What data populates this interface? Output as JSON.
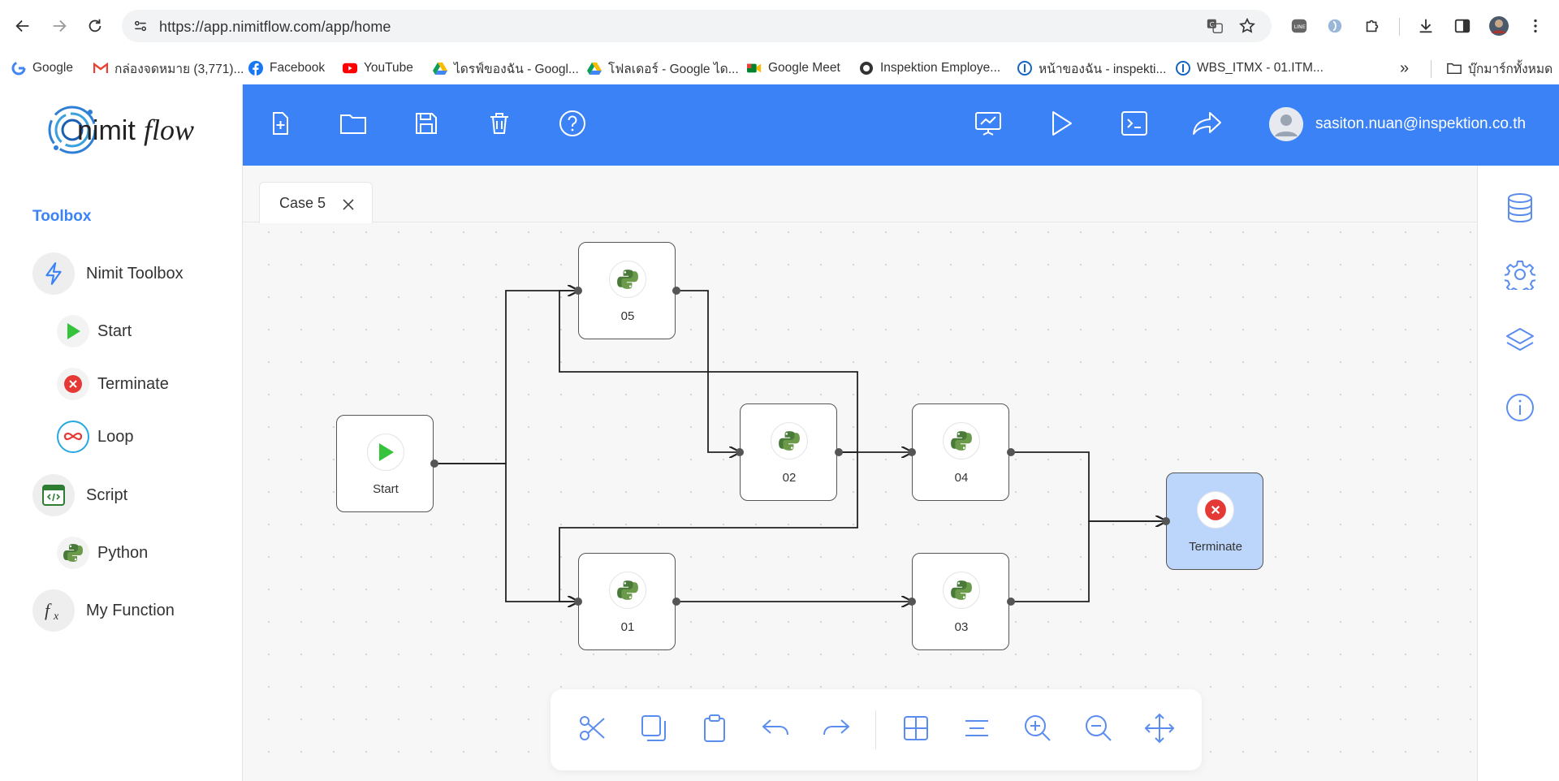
{
  "browser": {
    "url": "https://app.nimitflow.com/app/home",
    "bookmarks": [
      {
        "label": "Google",
        "icon": "google-icon"
      },
      {
        "label": "กล่องจดหมาย (3,771)...",
        "icon": "gmail-icon"
      },
      {
        "label": "Facebook",
        "icon": "facebook-icon"
      },
      {
        "label": "YouTube",
        "icon": "youtube-icon"
      },
      {
        "label": "ไดรฟ์ของฉัน - Googl...",
        "icon": "drive-icon"
      },
      {
        "label": "โฟลเดอร์ - Google ได...",
        "icon": "drive-icon"
      },
      {
        "label": "Google Meet",
        "icon": "meet-icon"
      },
      {
        "label": "Inspektion Employe...",
        "icon": "inspektion-icon"
      },
      {
        "label": "หน้าของฉัน - inspekti...",
        "icon": "info-icon"
      },
      {
        "label": "WBS_ITMX - 01.ITM...",
        "icon": "info-icon"
      }
    ],
    "bookmarks_more": "»",
    "all_bookmarks": "บุ๊กมาร์กทั้งหมด"
  },
  "app": {
    "logo_text_prefix": "nimit",
    "logo_text_suffix": "flow",
    "brand_color": "#3b82f6",
    "user_email": "sasiton.nuan@inspektion.co.th"
  },
  "sidebar": {
    "title": "Toolbox",
    "items": [
      {
        "label": "Nimit Toolbox",
        "icon": "lightning-icon",
        "level": 0
      },
      {
        "label": "Start",
        "icon": "play-icon",
        "level": 1
      },
      {
        "label": "Terminate",
        "icon": "terminate-icon",
        "level": 1
      },
      {
        "label": "Loop",
        "icon": "loop-icon",
        "level": 1
      },
      {
        "label": "Script",
        "icon": "script-icon",
        "level": 0
      },
      {
        "label": "Python",
        "icon": "python-icon",
        "level": 1
      },
      {
        "label": "My Function",
        "icon": "function-icon",
        "level": 0
      }
    ]
  },
  "tab": {
    "label": "Case 5"
  },
  "flow": {
    "nodes": [
      {
        "id": "start",
        "label": "Start",
        "type": "start"
      },
      {
        "id": "05",
        "label": "05",
        "type": "python"
      },
      {
        "id": "02",
        "label": "02",
        "type": "python"
      },
      {
        "id": "04",
        "label": "04",
        "type": "python"
      },
      {
        "id": "01",
        "label": "01",
        "type": "python"
      },
      {
        "id": "03",
        "label": "03",
        "type": "python"
      },
      {
        "id": "terminate",
        "label": "Terminate",
        "type": "terminate"
      }
    ],
    "edges": [
      [
        "start",
        "05"
      ],
      [
        "start",
        "01"
      ],
      [
        "05",
        "02"
      ],
      [
        "02",
        "04"
      ],
      [
        "02",
        "05"
      ],
      [
        "02",
        "01"
      ],
      [
        "01",
        "03"
      ],
      [
        "04",
        "terminate"
      ],
      [
        "03",
        "terminate"
      ]
    ]
  }
}
